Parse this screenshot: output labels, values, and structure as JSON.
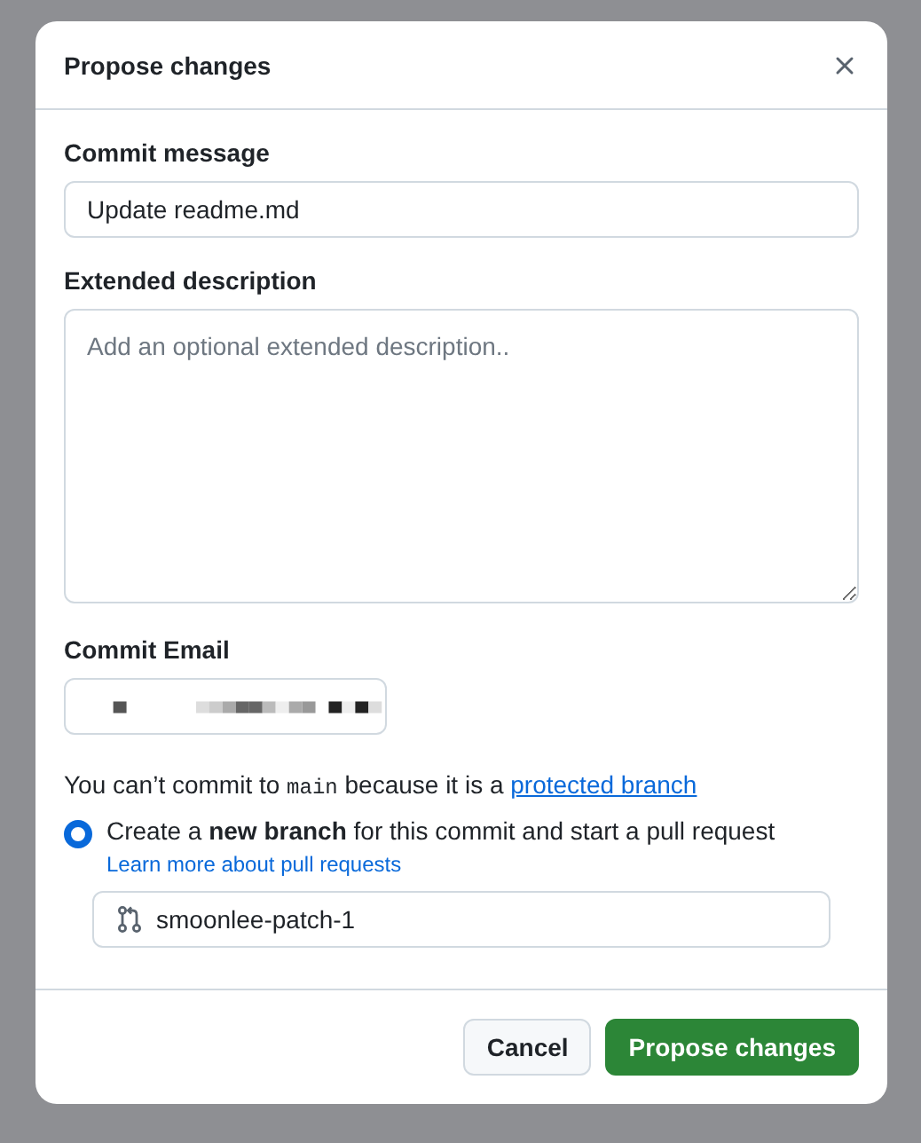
{
  "dialog": {
    "title": "Propose changes"
  },
  "commit_message": {
    "label": "Commit message",
    "value": "Update readme.md"
  },
  "extended_description": {
    "label": "Extended description",
    "placeholder": "Add an optional extended description.."
  },
  "commit_email": {
    "label": "Commit Email",
    "redacted": true
  },
  "notice": {
    "before": "You can’t commit to",
    "code": "main",
    "after": "because it is a",
    "link": "protected branch"
  },
  "options": [
    {
      "label": "Create a **new branch** for this commit and start a pull request",
      "selected": true,
      "help_link": "Learn more about pull requests",
      "branch_name": "smoonlee-patch-1"
    }
  ],
  "buttons": [
    {
      "kind": "secondary",
      "label": "Cancel"
    },
    {
      "kind": "primary",
      "label": "Propose changes"
    }
  ]
}
